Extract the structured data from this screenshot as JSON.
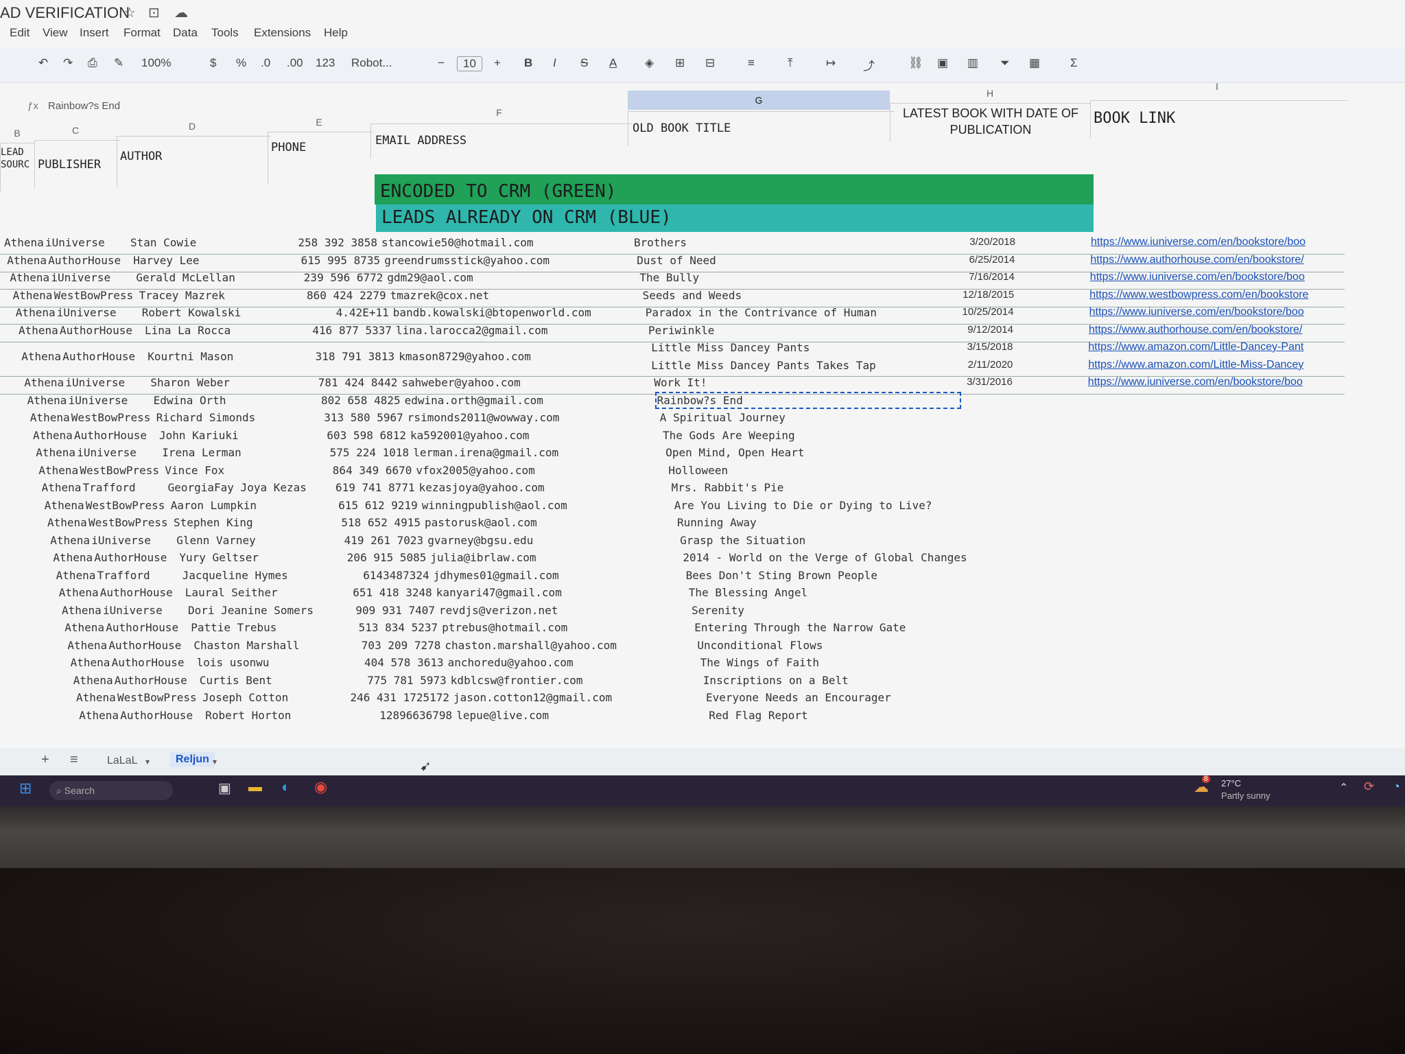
{
  "app": {
    "doc_title": "AD VERIFICATION",
    "menu": [
      "Edit",
      "View",
      "Insert",
      "Format",
      "Data",
      "Tools",
      "Extensions",
      "Help"
    ]
  },
  "toolbar": {
    "zoom": "100%",
    "currency": "$",
    "percent": "%",
    "dec_less": ".0",
    "dec_more": ".00",
    "num_format": "123",
    "font": "Robot...",
    "font_size": "10",
    "bold": "B",
    "italic": "I",
    "strike": "S",
    "text_color": "A",
    "sum": "Σ"
  },
  "formula_bar": {
    "cell_content": "Rainbow?s End"
  },
  "columns": {
    "letters": [
      "B",
      "C",
      "D",
      "E",
      "F",
      "G",
      "H",
      "I"
    ],
    "headers": {
      "source": "LEAD SOURC",
      "publisher": "PUBLISHER",
      "author": "AUTHOR",
      "phone": "PHONE",
      "email": "EMAIL ADDRESS",
      "old_title": "OLD BOOK TITLE",
      "latest": "LATEST BOOK WITH DATE OF PUBLICATION",
      "link": "BOOK LINK"
    }
  },
  "legend": {
    "green": "ENCODED TO CRM (GREEN)",
    "blue": "LEADS ALREADY ON CRM (BLUE)"
  },
  "rows": [
    {
      "source": "Athena",
      "publisher": "iUniverse",
      "author": "Stan Cowie",
      "phone": "258 392 3858",
      "email": "stancowie50@hotmail.com",
      "title": "Brothers",
      "date": "3/20/2018",
      "link": "https://www.iuniverse.com/en/bookstore/boo"
    },
    {
      "source": "Athena",
      "publisher": "AuthorHouse",
      "author": "Harvey Lee",
      "phone": "615 995 8735",
      "email": "greendrumsstick@yahoo.com",
      "title": "Dust of Need",
      "date": "6/25/2014",
      "link": "https://www.authorhouse.com/en/bookstore/"
    },
    {
      "source": "Athena",
      "publisher": "iUniverse",
      "author": "Gerald McLellan",
      "phone": "239 596 6772",
      "email": "gdm29@aol.com",
      "title": "The Bully",
      "date": "7/16/2014",
      "link": "https://www.iuniverse.com/en/bookstore/boo"
    },
    {
      "source": "Athena",
      "publisher": "WestBowPress",
      "author": "Tracey Mazrek",
      "phone": "860 424 2279",
      "email": "tmazrek@cox.net",
      "title": "Seeds and Weeds",
      "date": "12/18/2015",
      "link": "https://www.westbowpress.com/en/bookstore"
    },
    {
      "source": "Athena",
      "publisher": "iUniverse",
      "author": "Robert Kowalski",
      "phone": "4.42E+11",
      "email": "bandb.kowalski@btopenworld.com",
      "title": "Paradox in the Contrivance of Human",
      "date": "10/25/2014",
      "link": "https://www.iuniverse.com/en/bookstore/boo"
    },
    {
      "source": "Athena",
      "publisher": "AuthorHouse",
      "author": "Lina La Rocca",
      "phone": "416 877 5337",
      "email": "lina.larocca2@gmail.com",
      "title": "Periwinkle",
      "date": "9/12/2014",
      "link": "https://www.authorhouse.com/en/bookstore/"
    },
    {
      "source": "Athena",
      "publisher": "AuthorHouse",
      "author": "Kourtni Mason",
      "phone": "318 791 3813",
      "email": "kmason8729@yahoo.com",
      "title": "Little Miss Dancey Pants",
      "title2": "Little Miss Dancey Pants Takes Tap",
      "date": "3/15/2018",
      "date2": "2/11/2020",
      "link": "https://www.amazon.com/Little-Dancey-Pant",
      "link2": "https://www.amazon.com/Little-Miss-Dancey"
    },
    {
      "source": "Athena",
      "publisher": "iUniverse",
      "author": "Sharon Weber",
      "phone": "781 424 8442",
      "email": "sahweber@yahoo.com",
      "title": "Work It!",
      "date": "3/31/2016",
      "link": "https://www.iuniverse.com/en/bookstore/boo"
    },
    {
      "source": "Athena",
      "publisher": "iUniverse",
      "author": "Edwina Orth",
      "phone": "802 658 4825",
      "email": "edwina.orth@gmail.com",
      "title": "Rainbow?s End"
    },
    {
      "source": "Athena",
      "publisher": "WestBowPress",
      "author": "Richard Simonds",
      "phone": "313 580 5967",
      "email": "rsimonds2011@wowway.com",
      "title": "A Spiritual Journey"
    },
    {
      "source": "Athena",
      "publisher": "AuthorHouse",
      "author": "John Kariuki",
      "phone": "603 598 6812",
      "email": "ka592001@yahoo.com",
      "title": "The Gods Are Weeping"
    },
    {
      "source": "Athena",
      "publisher": "iUniverse",
      "author": "Irena Lerman",
      "phone": "575 224 1018",
      "email": "lerman.irena@gmail.com",
      "title": "Open Mind, Open Heart"
    },
    {
      "source": "Athena",
      "publisher": "WestBowPress",
      "author": "Vince Fox",
      "phone": "864 349 6670",
      "email": "vfox2005@yahoo.com",
      "title": "Holloween"
    },
    {
      "source": "Athena",
      "publisher": "Trafford",
      "author": "GeorgiaFay Joya Kezas",
      "phone": "619 741 8771",
      "email": "kezasjoya@yahoo.com",
      "title": "Mrs. Rabbit's Pie"
    },
    {
      "source": "Athena",
      "publisher": "WestBowPress",
      "author": "Aaron Lumpkin",
      "phone": "615 612 9219",
      "email": "winningpublish@aol.com",
      "title": "Are You Living to Die or Dying to Live?"
    },
    {
      "source": "Athena",
      "publisher": "WestBowPress",
      "author": "Stephen King",
      "phone": "518 652 4915",
      "email": "pastorusk@aol.com",
      "title": "Running Away"
    },
    {
      "source": "Athena",
      "publisher": "iUniverse",
      "author": "Glenn Varney",
      "phone": "419 261 7023",
      "email": "gvarney@bgsu.edu",
      "title": "Grasp the Situation"
    },
    {
      "source": "Athena",
      "publisher": "AuthorHouse",
      "author": "Yury Geltser",
      "phone": "206 915 5085",
      "email": "julia@ibrlaw.com",
      "title": "2014 - World on the Verge of Global Changes"
    },
    {
      "source": "Athena",
      "publisher": "Trafford",
      "author": "Jacqueline Hymes",
      "phone": "6143487324",
      "email": "jdhymes01@gmail.com",
      "title": "Bees Don't Sting Brown People"
    },
    {
      "source": "Athena",
      "publisher": "AuthorHouse",
      "author": "Laural Seither",
      "phone": "651 418 3248",
      "email": "kanyari47@gmail.com",
      "title": "The Blessing Angel"
    },
    {
      "source": "Athena",
      "publisher": "iUniverse",
      "author": "Dori Jeanine Somers",
      "phone": "909 931 7407",
      "email": "revdjs@verizon.net",
      "title": "Serenity"
    },
    {
      "source": "Athena",
      "publisher": "AuthorHouse",
      "author": "Pattie Trebus",
      "phone": "513 834 5237",
      "email": "ptrebus@hotmail.com",
      "title": "Entering Through the Narrow Gate"
    },
    {
      "source": "Athena",
      "publisher": "AuthorHouse",
      "author": "Chaston Marshall",
      "phone": "703 209 7278",
      "email": "chaston.marshall@yahoo.com",
      "title": "Unconditional Flows"
    },
    {
      "source": "Athena",
      "publisher": "AuthorHouse",
      "author": "lois usonwu",
      "phone": "404 578 3613",
      "email": "anchoredu@yahoo.com",
      "title": "The Wings of Faith"
    },
    {
      "source": "Athena",
      "publisher": "AuthorHouse",
      "author": "Curtis Bent",
      "phone": "775 781 5973",
      "email": "kdblcsw@frontier.com",
      "title": "Inscriptions on a Belt"
    },
    {
      "source": "Athena",
      "publisher": "WestBowPress",
      "author": "Joseph Cotton",
      "phone": "246 431 1725172",
      "email": "jason.cotton12@gmail.com",
      "title": "Everyone Needs an Encourager"
    },
    {
      "source": "Athena",
      "publisher": "AuthorHouse",
      "author": "Robert Horton",
      "phone": "12896636798",
      "email": "lepue@live.com",
      "title": "Red Flag Report"
    }
  ],
  "sheet_tabs": {
    "add": "+",
    "list": "≡",
    "tab1": "LaLaL",
    "tab2": "Reljun"
  },
  "taskbar": {
    "search": "Search",
    "weather_temp": "27°C",
    "weather_desc": "Partly sunny",
    "badge": "8"
  }
}
